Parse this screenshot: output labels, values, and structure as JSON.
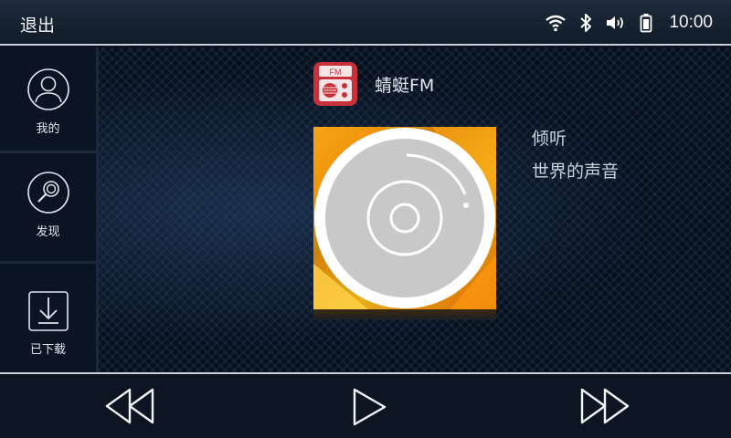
{
  "topbar": {
    "back_label": "退出",
    "clock": "10:00",
    "status_icons": [
      "wifi-icon",
      "bluetooth-icon",
      "volume-icon",
      "battery-icon"
    ]
  },
  "sidebar": {
    "items": [
      {
        "label": "我的",
        "icon": "user-icon"
      },
      {
        "label": "发现",
        "icon": "discover-icon"
      },
      {
        "label": "已下载",
        "icon": "download-icon"
      }
    ]
  },
  "app": {
    "name": "蜻蜓FM",
    "icon_text": "FM"
  },
  "slogan": {
    "line1": "倾听",
    "line2": "世界的声音"
  },
  "controls": [
    "previous-icon",
    "play-icon",
    "next-icon"
  ],
  "colors": {
    "accent": "#c8313a",
    "cover_orange": "#ff9a10",
    "disc_gray": "#c8c8c8"
  }
}
